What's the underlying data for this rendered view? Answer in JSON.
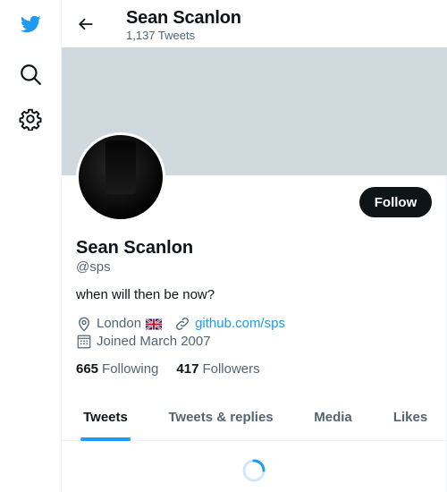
{
  "nav": {
    "logo_icon": "twitter-bird-icon",
    "search_icon": "search-icon",
    "settings_icon": "gear-icon",
    "brand_color": "#1d9bf0"
  },
  "header": {
    "title": "Sean Scanlon",
    "subtitle": "1,137 Tweets",
    "back_icon": "back-arrow-icon"
  },
  "profile": {
    "name": "Sean Scanlon",
    "handle": "@sps",
    "bio": "when will then be now?",
    "follow_label": "Follow",
    "location": "London",
    "location_flag": "uk-flag-icon",
    "website": "github.com/sps",
    "joined": "Joined March 2007",
    "banner_color": "#cfd9de"
  },
  "stats": {
    "following_count": "665",
    "following_label": "Following",
    "followers_count": "417",
    "followers_label": "Followers"
  },
  "tabs": [
    {
      "label": "Tweets",
      "active": true
    },
    {
      "label": "Tweets & replies",
      "active": false
    },
    {
      "label": "Media",
      "active": false
    },
    {
      "label": "Likes",
      "active": false
    }
  ],
  "loading_icon": "loading-spinner-icon"
}
